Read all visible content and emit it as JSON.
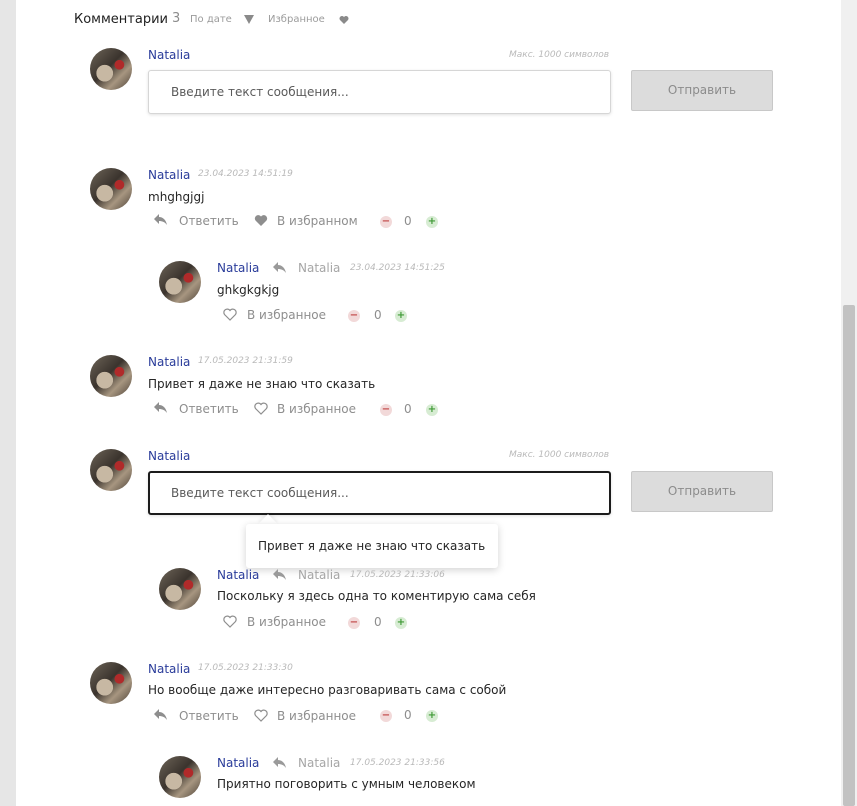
{
  "header": {
    "title": "Комментарии",
    "count": "3",
    "sort_label": "По дате",
    "favorites_label": "Избранное"
  },
  "form": {
    "author": "Natalia",
    "maxlen": "Макс. 1000 символов",
    "placeholder": "Введите текст сообщения...",
    "send_label": "Отправить"
  },
  "actions": {
    "reply": "Ответить",
    "in_favorites": "В избранном",
    "to_favorites": "В избранное"
  },
  "comments": [
    {
      "author": "Natalia",
      "date": "23.04.2023 14:51:19",
      "text": "mhghgjgj",
      "votes": "0",
      "favorited": true
    },
    {
      "author": "Natalia",
      "reply_to": "Natalia",
      "date": "23.04.2023 14:51:25",
      "text": "ghkgkgkjg",
      "votes": "0"
    },
    {
      "author": "Natalia",
      "date": "17.05.2023 21:31:59",
      "text": "Привет я даже не знаю что сказать",
      "votes": "0"
    },
    {
      "author": "Natalia",
      "reply_to": "Natalia",
      "date": "17.05.2023 21:33:06",
      "text": "Поскольку я здесь одна то коментирую сама себя",
      "votes": "0"
    },
    {
      "author": "Natalia",
      "date": "17.05.2023 21:33:30",
      "text": "Но вообще даже интересно разговаривать сама с собой",
      "votes": "0"
    },
    {
      "author": "Natalia",
      "reply_to": "Natalia",
      "date": "17.05.2023 21:33:56",
      "text": "Приятно поговорить с умным человеком",
      "votes": "0"
    }
  ],
  "reply_form": {
    "author": "Natalia",
    "tooltip": "Привет я даже не знаю что сказать"
  },
  "colors": {
    "author": "#2a3c9a",
    "vote_minus": "#c24848",
    "vote_plus": "#3f9a36"
  }
}
